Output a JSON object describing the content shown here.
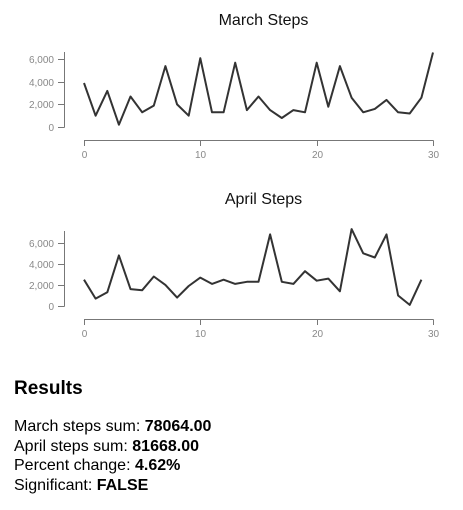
{
  "chart_data": [
    {
      "type": "line",
      "title": "March Steps",
      "xlim": [
        0,
        30
      ],
      "ylim": [
        0,
        7000
      ],
      "x_ticks": [
        0,
        10,
        20,
        30
      ],
      "y_ticks": [
        0,
        2000,
        4000,
        6000
      ],
      "y_tick_labels": [
        "0",
        "2,000",
        "4,000",
        "6,000"
      ],
      "x": [
        0,
        1,
        2,
        3,
        4,
        5,
        6,
        7,
        8,
        9,
        10,
        11,
        12,
        13,
        14,
        15,
        16,
        17,
        18,
        19,
        20,
        21,
        22,
        23,
        24,
        25,
        26,
        27,
        28,
        29,
        30
      ],
      "values": [
        3900,
        1000,
        3200,
        200,
        2700,
        1300,
        1900,
        5400,
        2000,
        1000,
        6100,
        1300,
        1300,
        5700,
        1500,
        2700,
        1500,
        800,
        1500,
        1300,
        5700,
        1800,
        5400,
        2600,
        1300,
        1600,
        2400,
        1300,
        1200,
        2600,
        6600
      ]
    },
    {
      "type": "line",
      "title": "April Steps",
      "xlim": [
        0,
        30
      ],
      "ylim": [
        0,
        7500
      ],
      "x_ticks": [
        0,
        10,
        20,
        30
      ],
      "y_ticks": [
        0,
        2000,
        4000,
        6000
      ],
      "y_tick_labels": [
        "0",
        "2,000",
        "4,000",
        "6,000"
      ],
      "x": [
        0,
        1,
        2,
        3,
        4,
        5,
        6,
        7,
        8,
        9,
        10,
        11,
        12,
        13,
        14,
        15,
        16,
        17,
        18,
        19,
        20,
        21,
        22,
        23,
        24,
        25,
        26,
        27,
        28,
        29
      ],
      "values": [
        2500,
        700,
        1300,
        4800,
        1600,
        1500,
        2800,
        2000,
        800,
        1900,
        2700,
        2100,
        2500,
        2100,
        2300,
        2300,
        6800,
        2300,
        2100,
        3300,
        2400,
        2600,
        1400,
        7300,
        5000,
        4600,
        6800,
        1000,
        100,
        2500
      ]
    }
  ],
  "results": {
    "heading": "Results",
    "march_label": "March steps sum: ",
    "march_value": "78064.00",
    "april_label": "April steps sum: ",
    "april_value": "81668.00",
    "percent_label": "Percent change: ",
    "percent_value": "4.62%",
    "significant_label": "Significant: ",
    "significant_value": "FALSE"
  }
}
